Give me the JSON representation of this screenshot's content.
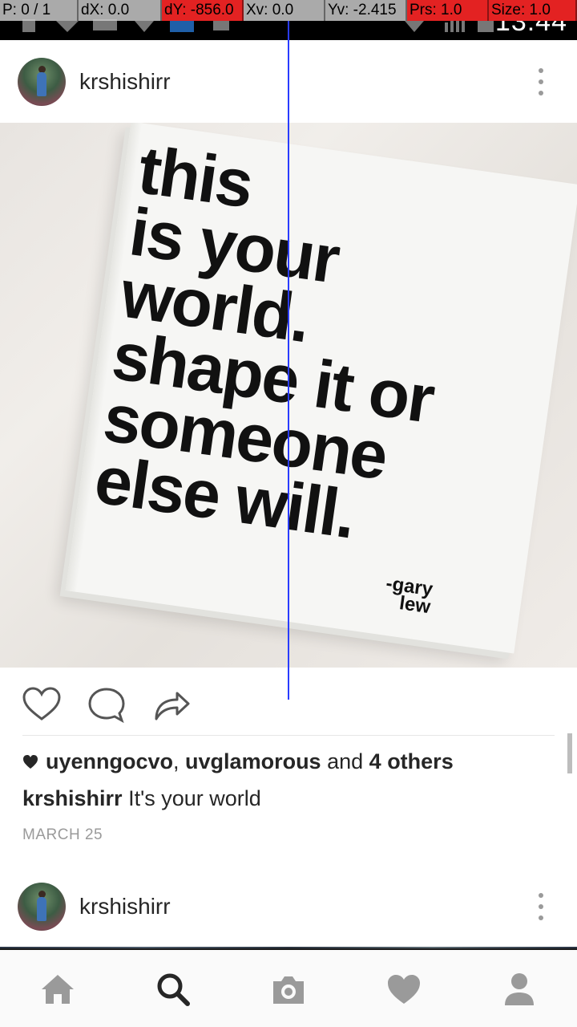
{
  "status_bar": {
    "time": "13:44",
    "debug": {
      "p": "P: 0 / 1",
      "dx": "dX: 0.0",
      "dy": "dY: -856.0",
      "xv": "Xv: 0.0",
      "yv": "Yv: -2.415",
      "prs": "Prs: 1.0",
      "size": "Size: 1.0"
    }
  },
  "post": {
    "username": "krshishirr",
    "image_text": {
      "lines": [
        "this",
        "is your",
        "world.",
        "shape it or",
        "someone",
        "else will."
      ],
      "author_line1": "-gary",
      "author_line2": "lew"
    },
    "likes": {
      "user1": "uyenngocvo",
      "user2": "uvglamorous",
      "and_text": "and",
      "others": "4 others"
    },
    "caption_user": "krshishirr",
    "caption_text": "It's your world",
    "date": "MARCH 25"
  },
  "next_post": {
    "username": "krshishirr"
  },
  "nav": {
    "items": [
      "home-icon",
      "search-icon",
      "camera-icon",
      "heart-icon",
      "profile-icon"
    ],
    "active": "search-icon"
  }
}
